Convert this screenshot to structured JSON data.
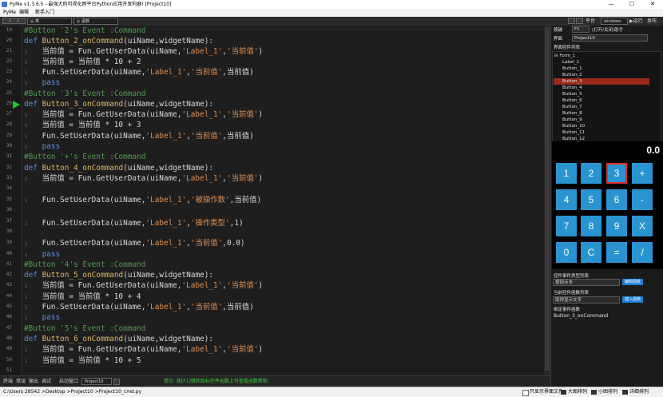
{
  "window": {
    "title": "PyMe v1.3.6.5 - 最强大的可视化跨平台Python应用开发利器!  [Project10]",
    "min": "—",
    "max": "☐",
    "close": "✕"
  },
  "menu": {
    "items": [
      "PyMe",
      "编辑",
      "新手入门"
    ]
  },
  "toolbar": {
    "combo1": "◎ 类",
    "combo2": "◎ 函数",
    "platform_label": "平台",
    "platform_value": "windows",
    "run_label": "▶运行",
    "publish_label": "发布"
  },
  "editor": {
    "line_numbers": [
      "19",
      "20",
      "21",
      "22",
      "23",
      "24",
      "25",
      "26",
      "27",
      "28",
      "29",
      "30",
      "31",
      "32",
      "33",
      "34",
      "35",
      "36",
      "37",
      "38",
      "39",
      "40",
      "41",
      "42",
      "43",
      "44",
      "45",
      "46",
      "47",
      "48",
      "49",
      "50",
      "51"
    ]
  },
  "bottom": {
    "tabs": [
      "终端",
      "错误",
      "输出",
      "调试"
    ],
    "startup_label": "启动窗口",
    "startup_value": "Project10",
    "hint": "提示: 按[F1]键回目标控件函数上可查看函数帮助."
  },
  "status": {
    "path": "C:\\Users\\28542\\Desktop\\Project10\\Project10_cmd.py",
    "path_display": "C:\\Users 28542 >Desktop >Project10 >Project10_cmd.py",
    "readonly": "只显示界面文件",
    "big_icons": "大图排列",
    "small_icons": "小图排列",
    "details": "详细排列"
  },
  "right_panel": {
    "button_label": "按键",
    "f1_value": "F1",
    "open_close": "(打开/关闭)助手",
    "form_label": "界面",
    "form_value": "Project10",
    "widget_list_label": "界面控件列表",
    "tree": {
      "root": "Form_1",
      "items": [
        "Label_1",
        "Button_1",
        "Button_2",
        "Button_3",
        "Button_4",
        "Button_5",
        "Button_6",
        "Button_7",
        "Button_8",
        "Button_9",
        "Button_10",
        "Button_11",
        "Button_12"
      ],
      "selected_index": 3
    },
    "display_value": "0.0",
    "calc_buttons": [
      "1",
      "2",
      "3",
      "+",
      "4",
      "5",
      "6",
      "-",
      "7",
      "8",
      "9",
      "X",
      "0",
      "C",
      "=",
      "/"
    ],
    "calc_selected_index": 2,
    "func_type_label": "控件事件类型列表",
    "func_type_value": "按钮点击",
    "func_type_btn": "编辑函数",
    "current_func_label": "当前控件函数列表",
    "current_func_value": "取得显示文字",
    "current_func_btn": "插入函数",
    "bound_event_label": "绑定事件函数",
    "bound_event_value": "Button_3_onCommand"
  },
  "colors": {
    "comment": "#4e9a4e",
    "keyword": "#5b8fd6",
    "funcname": "#e0b860",
    "string": "#e09050",
    "calc_button": "#2a94d1",
    "selection": "#9b2a1a"
  }
}
